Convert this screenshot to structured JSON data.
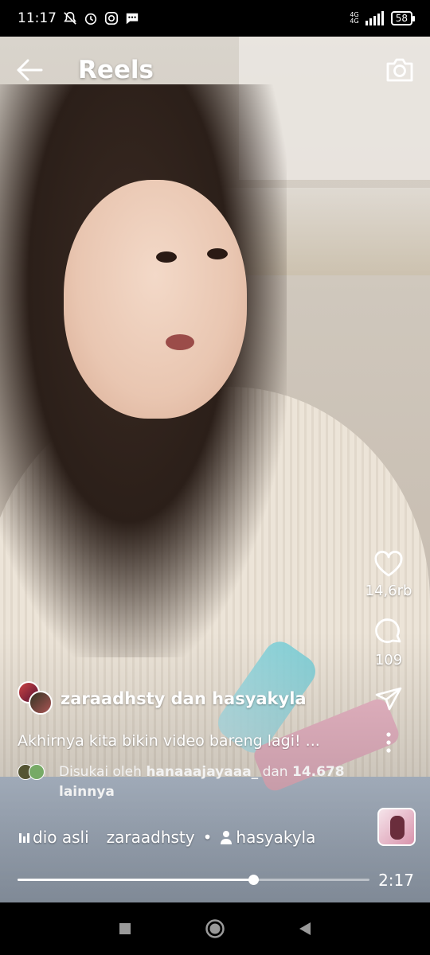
{
  "status_bar": {
    "time": "11:17",
    "network_top": "4G",
    "network_bottom": "4G",
    "battery": "58"
  },
  "header": {
    "title": "Reels"
  },
  "actions": {
    "likes": "14,6rb",
    "comments": "109"
  },
  "post": {
    "creators": "zaraadhsty dan hasyakyla",
    "caption": "Akhirnya kita bikin video bareng lagi! ...",
    "liked_prefix": "Disukai oleh",
    "liked_user": "hanaaajayaaa_",
    "liked_conj": "dan",
    "liked_count": "14.678",
    "liked_suffix": "lainnya",
    "audio_label": "dio asli",
    "audio_owner": "zaraadhsty",
    "separator": "•",
    "tagged_user": "hasyakyla"
  },
  "player": {
    "progress": 0.67,
    "remaining_time": "2:17"
  },
  "colors": {
    "background": "#000000",
    "text": "#ffffff"
  }
}
